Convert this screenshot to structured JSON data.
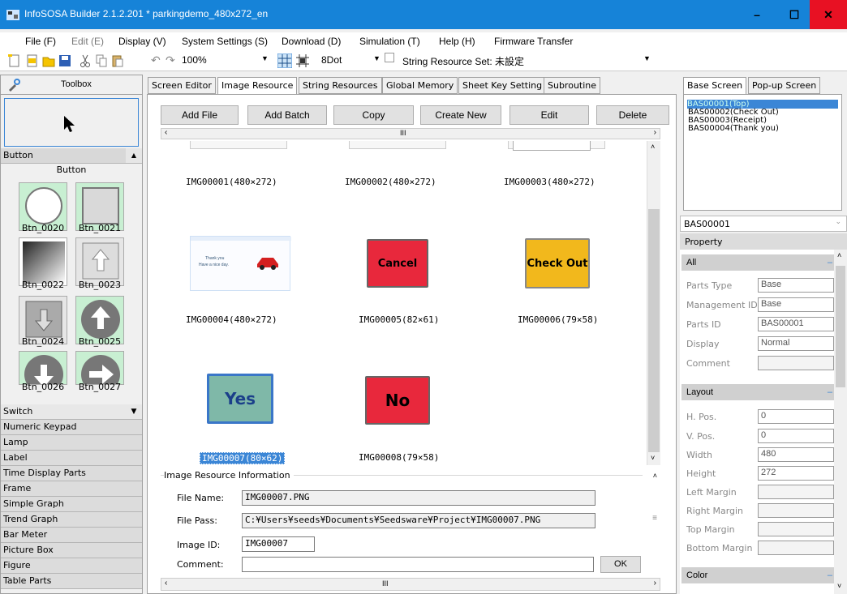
{
  "window": {
    "title": "InfoSOSA Builder 2.1.2.201 * parkingdemo_480x272_en",
    "minimize": "–",
    "maximize": "☐",
    "close": "✕"
  },
  "menu": [
    "File (F)",
    "Edit (E)",
    "Display (V)",
    "System Settings (S)",
    "Download (D)",
    "Simulation (T)",
    "Help (H)",
    "Firmware Transfer"
  ],
  "toolbar": {
    "zoom": "100%",
    "dot": "8Dot",
    "string_resource_set": "String Resource Set: 未設定"
  },
  "toolbox": {
    "title": "Toolbox",
    "button_category": "Button",
    "button_subheader": "Button",
    "buttons": [
      "Btn_0020",
      "Btn_0021",
      "Btn_0022",
      "Btn_0023",
      "Btn_0024",
      "Btn_0025",
      "Btn_0026",
      "Btn_0027"
    ],
    "categories": [
      "Switch",
      "Numeric Keypad",
      "Lamp",
      "Label",
      "Time Display Parts",
      "Frame",
      "Simple Graph",
      "Trend Graph",
      "Bar Meter",
      "Picture Box",
      "Figure",
      "Table Parts"
    ]
  },
  "tabs": [
    "Screen Editor",
    "Image Resource",
    "String Resources",
    "Global Memory",
    "Sheet Key Setting",
    "Subroutine"
  ],
  "actions": [
    "Add File",
    "Add Batch",
    "Copy",
    "Create New",
    "Edit",
    "Delete"
  ],
  "scroll_grip": "III",
  "images": [
    {
      "label": "IMG00001(480×272)"
    },
    {
      "label": "IMG00002(480×272)"
    },
    {
      "label": "IMG00003(480×272)"
    },
    {
      "label": "IMG00004(480×272)",
      "thumb_line1": "Thank you",
      "thumb_line2": "Have a nice day."
    },
    {
      "label": "IMG00005(82×61)",
      "button_text": "Cancel",
      "color": "#e8283c"
    },
    {
      "label": "IMG00006(79×58)",
      "button_text": "Check Out",
      "color": "#f2b81c"
    },
    {
      "label": "IMG00007(80×62)",
      "button_text": "Yes",
      "color": "#7fb8a8"
    },
    {
      "label": "IMG00008(79×58)",
      "button_text": "No",
      "color": "#e8283c"
    }
  ],
  "info": {
    "title": "Image Resource Information",
    "file_name_label": "File Name:",
    "file_name": "IMG00007.PNG",
    "file_pass_label": "File Pass:",
    "file_pass": "C:¥Users¥seeds¥Documents¥Seedsware¥Project¥IMG00007.PNG",
    "image_id_label": "Image ID:",
    "image_id": "IMG00007",
    "comment_label": "Comment:",
    "ok": "OK"
  },
  "screens": {
    "tabs": [
      "Base Screen",
      "Pop-up Screen"
    ],
    "items": [
      "BAS00001(Top)",
      "BAS00002(Check Out)",
      "BAS00003(Receipt)",
      "BAS00004(Thank you)"
    ]
  },
  "property": {
    "selector": "BAS00001",
    "title": "Property",
    "all_section": "All",
    "all": [
      {
        "label": "Parts Type",
        "value": "Base"
      },
      {
        "label": "Management ID",
        "value": "Base"
      },
      {
        "label": "Parts ID",
        "value": "BAS00001"
      },
      {
        "label": "Display",
        "value": "Normal"
      },
      {
        "label": "Comment",
        "value": ""
      }
    ],
    "layout_section": "Layout",
    "layout": [
      {
        "label": "H. Pos.",
        "value": "0"
      },
      {
        "label": "V. Pos.",
        "value": "0"
      },
      {
        "label": "Width",
        "value": "480"
      },
      {
        "label": "Height",
        "value": "272"
      },
      {
        "label": "Left Margin",
        "value": ""
      },
      {
        "label": "Right Margin",
        "value": ""
      },
      {
        "label": "Top Margin",
        "value": ""
      },
      {
        "label": "Bottom Margin",
        "value": ""
      }
    ],
    "color_section": "Color"
  }
}
